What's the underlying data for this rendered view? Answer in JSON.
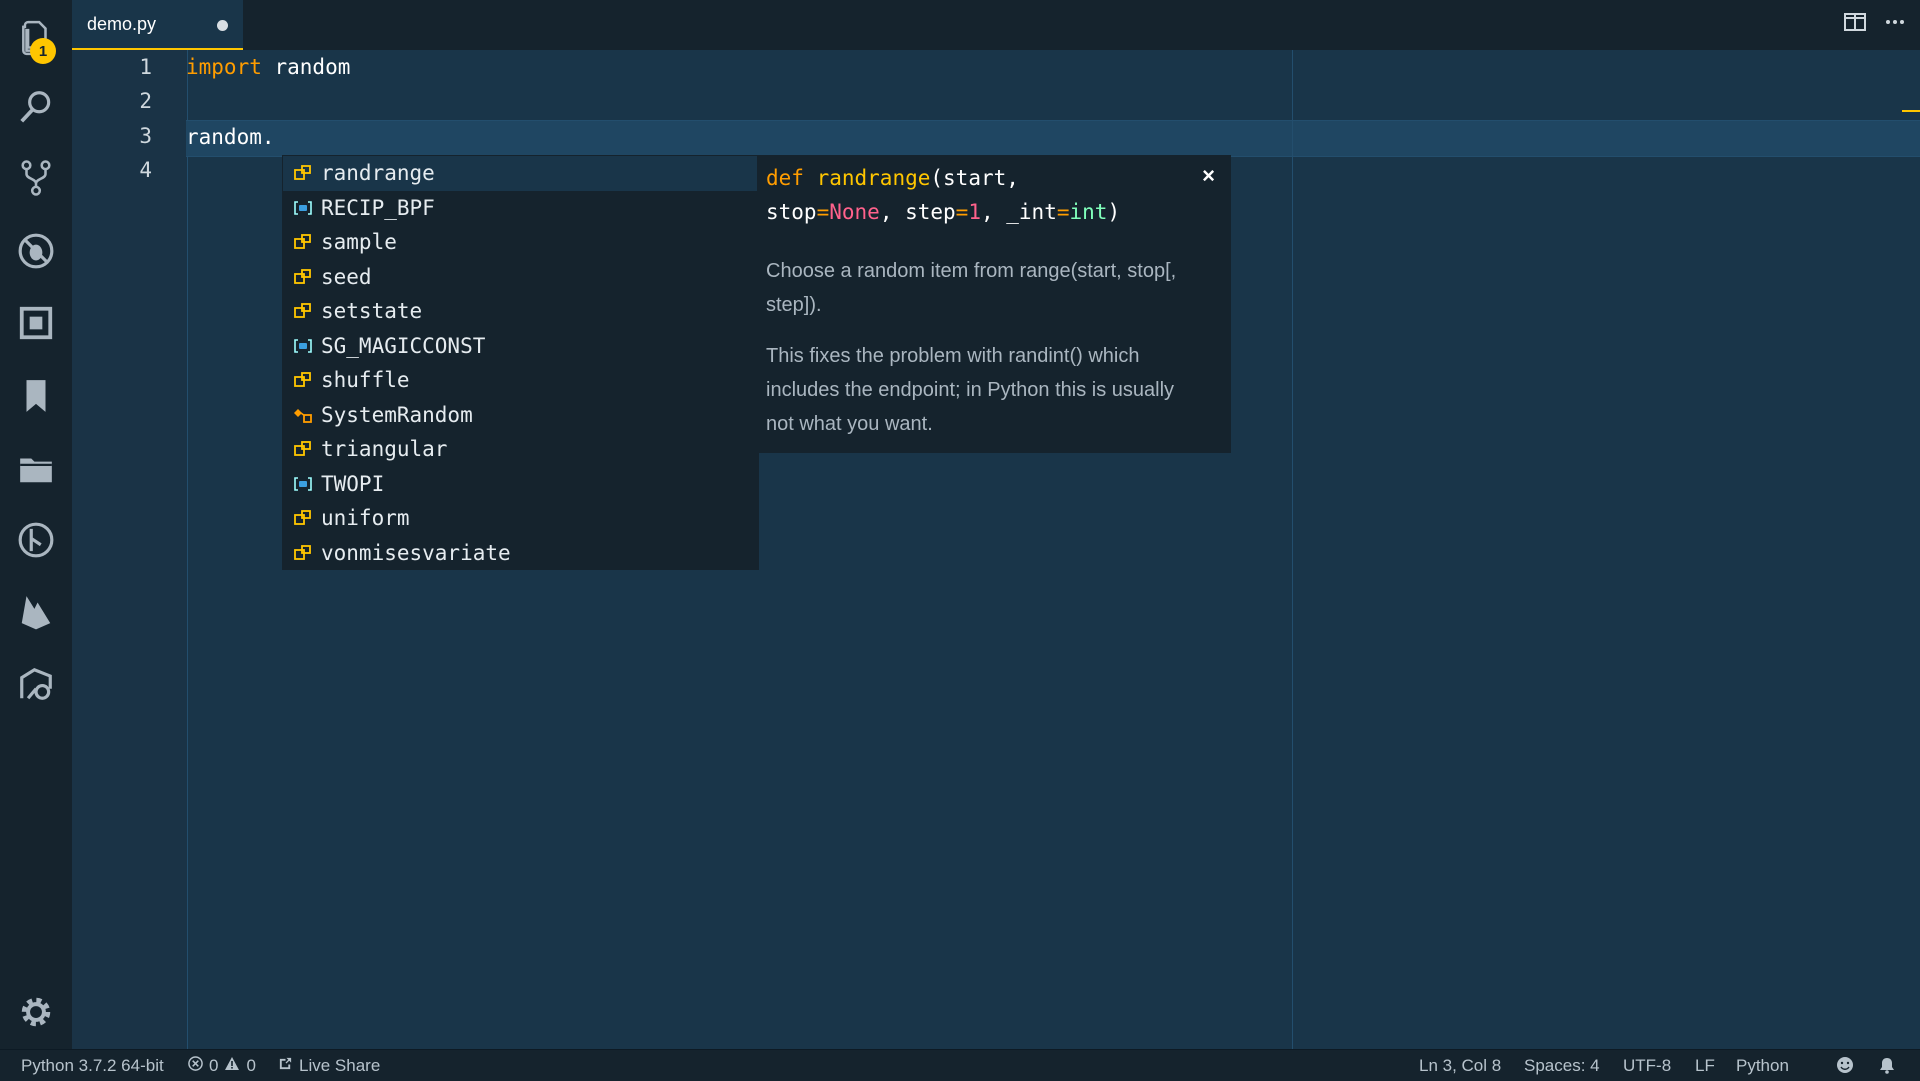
{
  "activity_bar": {
    "badge": "1",
    "icons": [
      "explorer-icon",
      "search-icon",
      "source-control-icon",
      "debug-icon",
      "extensions-icon",
      "bookmarks-icon",
      "project-manager-icon",
      "gitlens-icon",
      "firebase-icon",
      "remote-explorer-icon"
    ],
    "settings_icon": "gear-icon"
  },
  "tab": {
    "label": "demo.py"
  },
  "editor": {
    "line_numbers": [
      "1",
      "2",
      "3",
      "4"
    ],
    "lines": {
      "l1_keyword": "import",
      "l1_rest": " random",
      "l3": "random."
    }
  },
  "suggestions": [
    {
      "label": "randrange",
      "kind": "method"
    },
    {
      "label": "RECIP_BPF",
      "kind": "variable"
    },
    {
      "label": "sample",
      "kind": "method"
    },
    {
      "label": "seed",
      "kind": "method"
    },
    {
      "label": "setstate",
      "kind": "method"
    },
    {
      "label": "SG_MAGICCONST",
      "kind": "variable"
    },
    {
      "label": "shuffle",
      "kind": "method"
    },
    {
      "label": "SystemRandom",
      "kind": "class"
    },
    {
      "label": "triangular",
      "kind": "method"
    },
    {
      "label": "TWOPI",
      "kind": "variable"
    },
    {
      "label": "uniform",
      "kind": "method"
    },
    {
      "label": "vonmisesvariate",
      "kind": "method"
    }
  ],
  "doc": {
    "sig_def": "def",
    "sig_name": "randrange",
    "sig_open": "(start,",
    "sig_stop": "stop",
    "sig_eq1": "=",
    "sig_none": "None",
    "sig_comma1": ", step",
    "sig_eq2": "=",
    "sig_one": "1",
    "sig_comma2": ", _int",
    "sig_eq3": "=",
    "sig_int": "int",
    "sig_close": ")",
    "close": "×",
    "para1_line1": "Choose a random item from range(start, stop[,",
    "para1_line2": "step]).",
    "para2_line1": "This fixes the problem with randint() which",
    "para2_line2": "includes the endpoint; in Python this is usually",
    "para2_line3": "not what you want."
  },
  "status": {
    "interpreter": "Python 3.7.2 64-bit",
    "errors": "0",
    "warnings": "0",
    "live_share": "Live Share",
    "position": "Ln 3, Col 8",
    "spaces": "Spaces: 4",
    "encoding": "UTF-8",
    "eol": "LF",
    "language": "Python"
  },
  "colors": {
    "accent": "#ffc600",
    "background": "#193549",
    "sidebar": "#15232d"
  }
}
